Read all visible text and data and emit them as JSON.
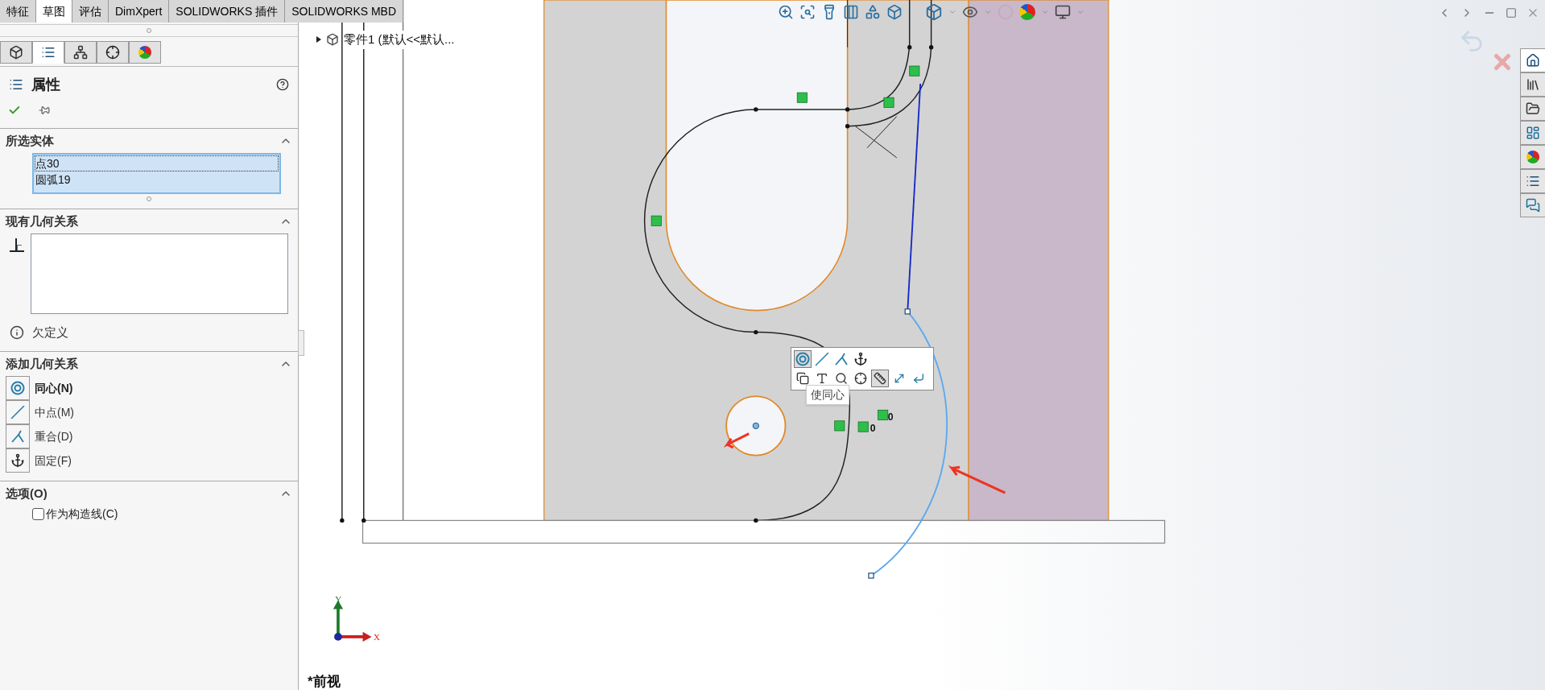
{
  "tabs": [
    {
      "label": "特征",
      "selected": false
    },
    {
      "label": "草图",
      "selected": true
    },
    {
      "label": "评估",
      "selected": false
    },
    {
      "label": "DimXpert",
      "selected": false
    },
    {
      "label": "SOLIDWORKS 插件",
      "selected": false
    },
    {
      "label": "SOLIDWORKS MBD",
      "selected": false
    }
  ],
  "panel_tabs": [
    {
      "kind": "feature-tree",
      "selected": false
    },
    {
      "kind": "property",
      "selected": true
    },
    {
      "kind": "configuration",
      "selected": false
    },
    {
      "kind": "dimxpert",
      "selected": false
    },
    {
      "kind": "display",
      "selected": false
    }
  ],
  "property_manager": {
    "title": "属性"
  },
  "selected_entities": {
    "title": "所选实体",
    "items": [
      {
        "label": "点30",
        "focused": true
      },
      {
        "label": "圆弧19",
        "focused": false
      }
    ]
  },
  "existing_relations": {
    "title": "现有几何关系",
    "status": "欠定义"
  },
  "add_relations": {
    "title": "添加几何关系",
    "items": [
      {
        "kind": "concentric",
        "label": "同心(N)",
        "selected": true
      },
      {
        "kind": "midpoint",
        "label": "中点(M)",
        "selected": false
      },
      {
        "kind": "coincident",
        "label": "重合(D)",
        "selected": false
      },
      {
        "kind": "fix",
        "label": "固定(F)",
        "selected": false
      }
    ]
  },
  "options": {
    "title": "选项(O)",
    "items": [
      {
        "label": "作为构造线(C)",
        "checked": false
      }
    ]
  },
  "feature_tree": {
    "label": "零件1 (默认<<默认..."
  },
  "context_toolbar": {
    "row_1": [
      {
        "kind": "concentric",
        "selected": true
      },
      {
        "kind": "midpoint",
        "selected": false
      },
      {
        "kind": "coincident",
        "selected": false
      },
      {
        "kind": "fix",
        "selected": false
      }
    ],
    "row_2": [
      {
        "kind": "select",
        "selected": false
      },
      {
        "kind": "text",
        "selected": false
      },
      {
        "kind": "zoom",
        "selected": false
      },
      {
        "kind": "target",
        "selected": false
      },
      {
        "kind": "dimension",
        "selected": true
      },
      {
        "kind": "arrow",
        "selected": false
      },
      {
        "kind": "exit",
        "selected": false
      }
    ],
    "tooltip": "使同心"
  },
  "relation_labels": [
    "0",
    "0"
  ],
  "axes": {
    "x": "X",
    "y": "Y"
  },
  "view_name": "*前视",
  "task_pane": [
    {
      "kind": "home",
      "selected": true
    },
    {
      "kind": "library",
      "selected": false
    },
    {
      "kind": "folder",
      "selected": false
    },
    {
      "kind": "layout",
      "selected": false
    },
    {
      "kind": "appearance",
      "selected": false
    },
    {
      "kind": "properties",
      "selected": false
    },
    {
      "kind": "forum",
      "selected": false
    }
  ]
}
